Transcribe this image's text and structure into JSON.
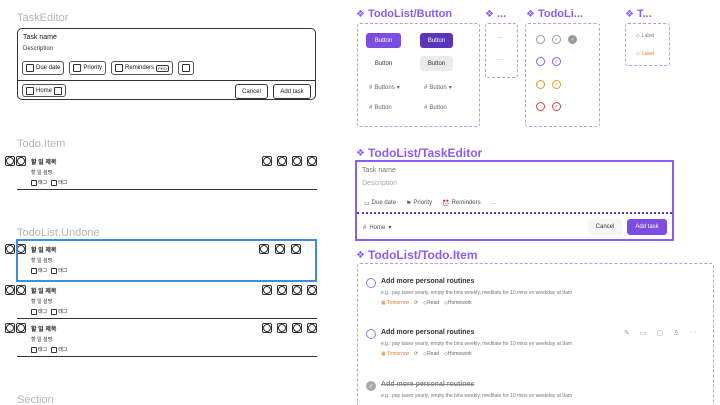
{
  "left": {
    "task_editor_label": "TaskEditor",
    "task_editor": {
      "task_name": "Task name",
      "description": "Description",
      "chips": [
        "Due date",
        "Priority",
        "Reminders"
      ],
      "pro_badge": "PRO",
      "home": "Home",
      "cancel": "Cancel",
      "add_task": "Add task"
    },
    "todo_item_label": "Todo.Item",
    "undone_label": "TodoList.Undone",
    "section_label": "Section",
    "todo": {
      "title": "할 일 제목",
      "description": "할 일 설명",
      "tag": "태그"
    }
  },
  "right": {
    "button_title": "TodoList/Button",
    "dots_title": "...",
    "todoli_title": "TodoLi...",
    "t_title": "T...",
    "buttons": {
      "button": "Button",
      "buttons": "Buttons",
      "ellipsis": "···"
    },
    "labels": {
      "label": "Label"
    },
    "task_editor_title": "TodoList/TaskEditor",
    "task_editor": {
      "task_name": "Task name",
      "description": "Description",
      "due_date": "Due date",
      "priority": "Priority",
      "reminders": "Reminders",
      "more": "···",
      "home": "Home",
      "cancel": "Cancel",
      "add_task": "Add task"
    },
    "todo_item_title": "TodoList/Todo.Item",
    "todo_items": [
      {
        "title": "Add more personal routines",
        "desc": "e.g.: pay taxes yearly, empty the bins weekly, meditate for 10 mins ev weekday at 9am",
        "tomorrow": "Tomorrow",
        "read": "Read",
        "homework": "Homework",
        "done": false
      },
      {
        "title": "Add more personal routines",
        "desc": "e.g.: pay taxes yearly, empty the bins weekly, meditate for 10 mins ev weekday at 9am",
        "tomorrow": "Tomorrow",
        "read": "Read",
        "homework": "Homework",
        "done": false
      },
      {
        "title": "Add more personal routines",
        "desc": "e.g.: pay taxes yearly, empty the bins weekly, meditate for 10 mins ev weekday at 9am",
        "done": true
      }
    ]
  },
  "colors": {
    "accent": "#8b5cf6",
    "button_primary": "#7c4ddf",
    "selection_blue": "#3b8fdd",
    "tomorrow_orange": "#e07b2a",
    "check_green": "#3aa34a",
    "priority_orange": "#e09a2a",
    "priority_red": "#d8453a"
  }
}
